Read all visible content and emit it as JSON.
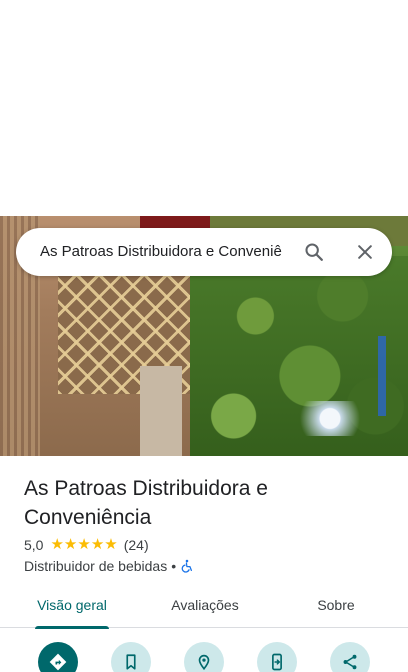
{
  "search": {
    "query": "As Patroas Distribuidora e Conveniê"
  },
  "place": {
    "name": "As Patroas Distribuidora e Conveniência",
    "rating": "5,0",
    "stars": [
      "★",
      "★",
      "★",
      "★",
      "★"
    ],
    "review_count": "(24)",
    "category": "Distribuidor de bebidas",
    "separator": "•"
  },
  "tabs": [
    {
      "label": "Visão geral",
      "active": true
    },
    {
      "label": "Avaliações",
      "active": false
    },
    {
      "label": "Sobre",
      "active": false
    }
  ],
  "actions": [
    {
      "icon": "directions-icon"
    },
    {
      "icon": "bookmark-icon"
    },
    {
      "icon": "location-pin-icon"
    },
    {
      "icon": "send-to-phone-icon"
    },
    {
      "icon": "share-icon"
    }
  ],
  "colors": {
    "accent": "#00686b",
    "action_bg": "#cde8ea",
    "star": "#fbbc04"
  }
}
